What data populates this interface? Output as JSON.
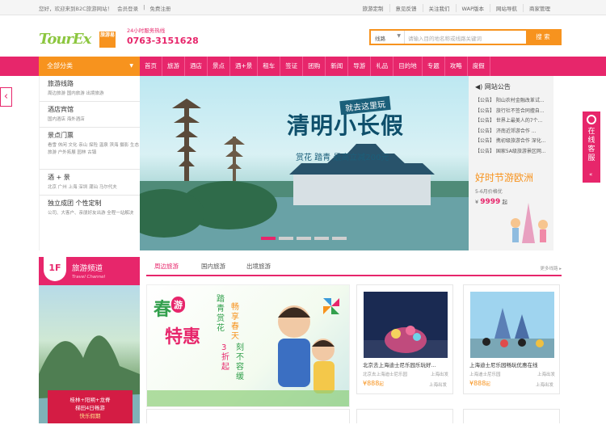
{
  "topbar": {
    "welcome": "您好，欢迎来到B2C旅游网站！",
    "login": "会员登录",
    "register": "免费注册",
    "links": [
      "旅游定制",
      "意见反馈",
      "关注我们",
      "WAP版本",
      "网站导航",
      "商家管理"
    ]
  },
  "header": {
    "logo": "TourEx",
    "logo_badge": "旅游易",
    "hotline_label": "24小时服务热线",
    "hotline_number": "0763-3151628"
  },
  "search": {
    "type": "线路",
    "placeholder": "请输入目的地名称或线路关键词",
    "button": "搜 索"
  },
  "nav": {
    "category_label": "全部分类",
    "items": [
      "首页",
      "旅游",
      "酒店",
      "景点",
      "酒+景",
      "租车",
      "签证",
      "团购",
      "新闻",
      "导游",
      "礼品",
      "目的地",
      "专题",
      "攻略",
      "度假"
    ]
  },
  "sidebar": [
    {
      "title": "旅游线路",
      "subs": "周边旅游  国内旅游  出境旅游"
    },
    {
      "title": "酒店宾馆",
      "subs": "国内酒店  海外酒店"
    },
    {
      "title": "景点门票",
      "subs": "看雪  休闲  文化  亲山  探险  温泉  滨海  摄影  生态旅游  户外拓展  园林  古镇"
    },
    {
      "title": "酒 + 景",
      "subs": "北京  广州  上海  深圳  潮汕  马尔代夫"
    },
    {
      "title": "独立成团 个性定制",
      "subs": "公司、大客户、亲朋好友出游  全程一站解决"
    }
  ],
  "banner": {
    "tag": "就去这里玩",
    "headline": "清明小长假",
    "offer": "赏花 踏青 最高立减200元",
    "dots": 5,
    "active_dot": 0
  },
  "notices": {
    "title": "网站公告",
    "items": [
      "【公告】 阳山农村金融改革试...",
      "【公告】 旅行社不签合同擅自...",
      "【公告】 世界上最美人的7个...",
      "【公告】 济南近郊游合作 ...",
      "【公告】 携初级旅游合作 深化...",
      "【公告】 国家5A级旅游景区网..."
    ],
    "promo_title": "好时节游欧洲",
    "promo_date": "5-6月价格优",
    "promo_price": "9999",
    "promo_unit": "起"
  },
  "service": {
    "label": "在线客服"
  },
  "channel": {
    "floor": "1F",
    "title": "旅游频道",
    "subtitle": "Travel Channel",
    "promo_line1": "桂林+阳朔+龙脊",
    "promo_line2": "梯田4日畅游",
    "promo_line3": "快乐假期"
  },
  "tabs": {
    "items": [
      "周边旅游",
      "国内旅游",
      "出境旅游"
    ],
    "active": 0,
    "more": "更多线路 ▸"
  },
  "promo": {
    "title1": "春",
    "title1_badge": "游",
    "title2": "特惠",
    "line1": "踏青赏花",
    "line2": "畅享春天",
    "discount": "3折起",
    "line3": "刻不容缓"
  },
  "cards": [
    {
      "name": "北京去上海迪士尼乐园乐玩好...",
      "sub": "北京去上海迪士尼乐园",
      "city": "上海出发",
      "price": "¥888",
      "unit": "起",
      "from": "上海出发"
    },
    {
      "name": "上海迪士尼乐园畅玩优惠在线",
      "sub": "上海迪士尼乐园",
      "city": "上海出发",
      "price": "¥888",
      "unit": "起",
      "from": "上海出发"
    }
  ]
}
